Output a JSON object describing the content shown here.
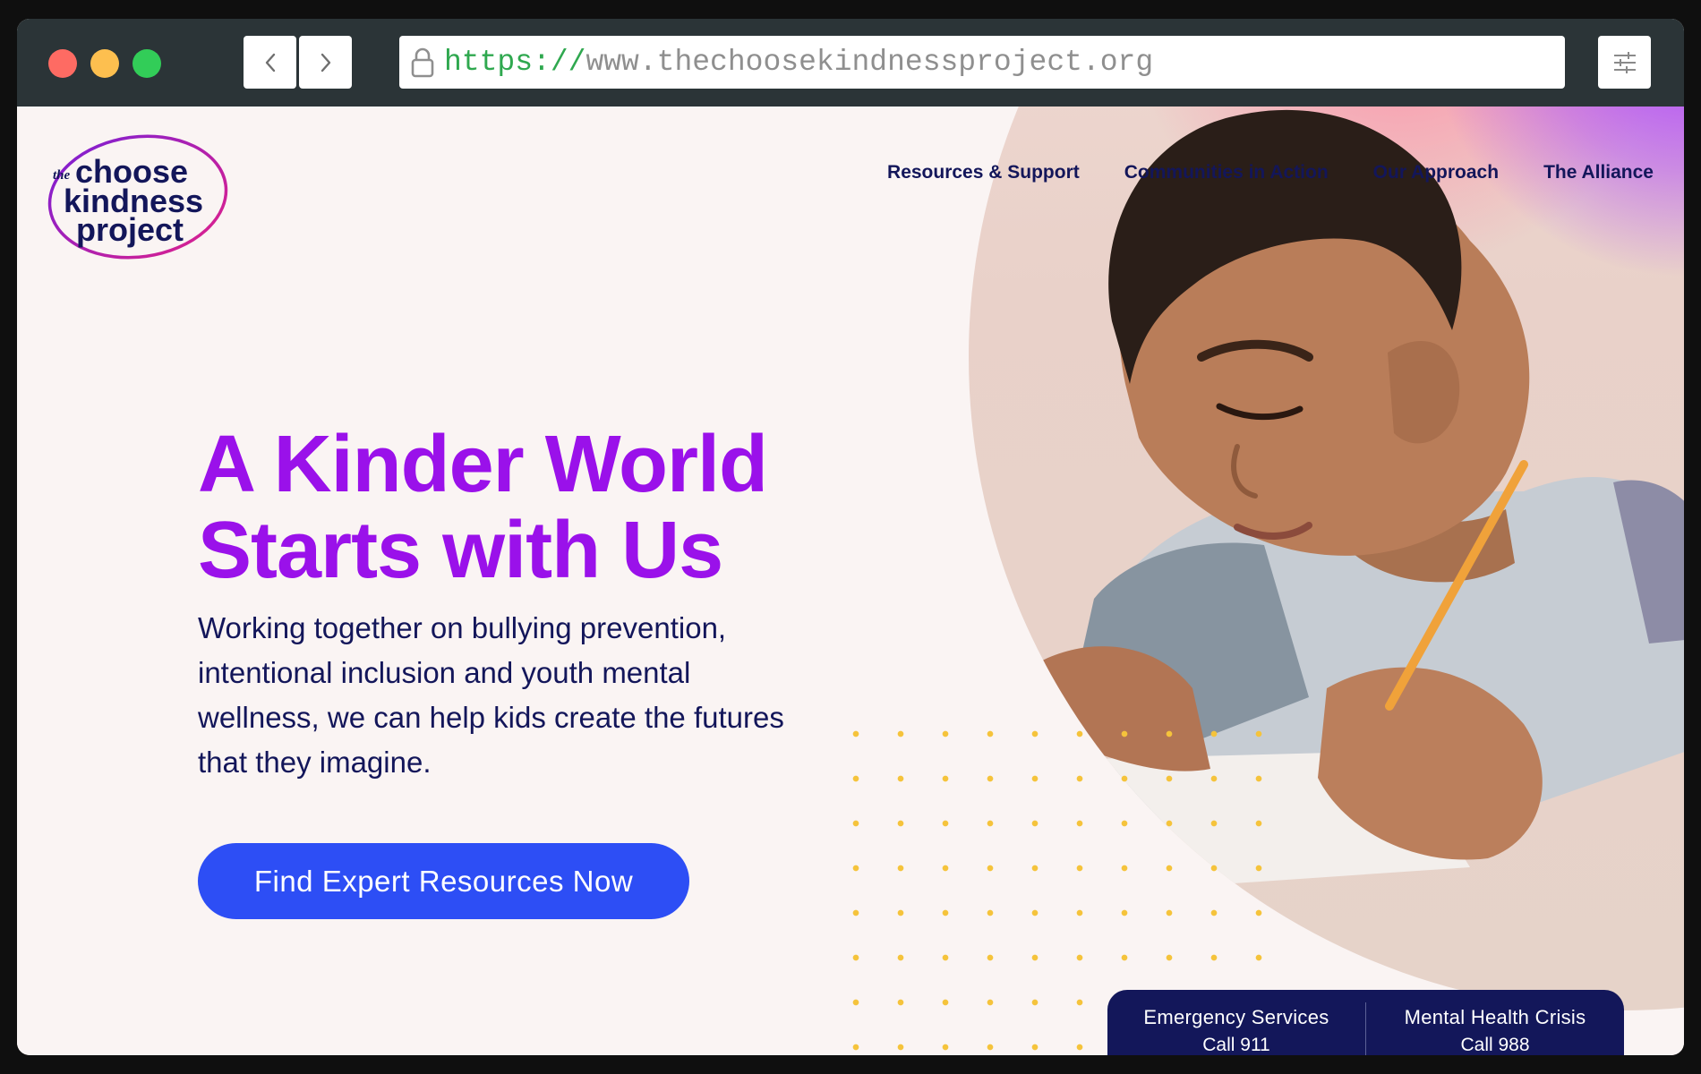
{
  "browser": {
    "url_protocol": "https://",
    "url_rest": "www.thechoosekindnessproject.org"
  },
  "logo": {
    "line_prefix": "the",
    "line1": "choose",
    "line2": "kindness",
    "line3": "project"
  },
  "nav": {
    "items": [
      {
        "label": "Resources & Support"
      },
      {
        "label": "Communities in Action"
      },
      {
        "label": "Our Approach"
      },
      {
        "label": "The Alliance"
      }
    ]
  },
  "hero": {
    "title_line1": "A Kinder World",
    "title_line2": "Starts with Us",
    "body_line1": "Working together on bullying prevention,",
    "body_line2": "intentional inclusion and youth mental",
    "body_line3": "wellness, we can help kids create the futures",
    "body_line4": "that they imagine.",
    "cta_label": "Find Expert Resources Now"
  },
  "crisis": {
    "emergency_label": "Emergency Services",
    "emergency_call": "Call 911",
    "mental_label": "Mental Health Crisis",
    "mental_call": "Call 988"
  },
  "colors": {
    "accent_purple": "#9a11ea",
    "navy": "#13165a",
    "cta_blue": "#2d4ef5",
    "dot_yellow": "#f5c33b",
    "page_bg": "#faf4f3"
  }
}
